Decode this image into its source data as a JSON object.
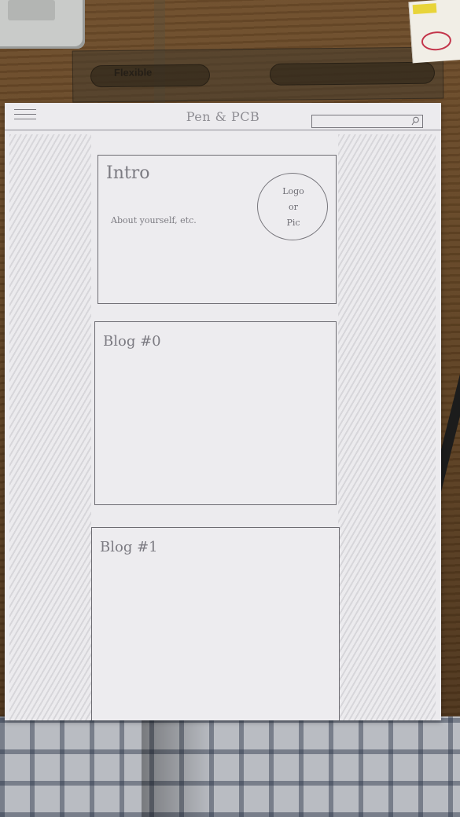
{
  "site": {
    "title": "Pen & PCB",
    "menu_icon": "hamburger-menu-icon",
    "search_icon": "search-icon"
  },
  "intro": {
    "title": "Intro",
    "text": "About yourself, etc.",
    "logo_line1": "Logo",
    "logo_line2": "or",
    "logo_line3": "Pic"
  },
  "blogs": [
    {
      "title": "Blog #0"
    },
    {
      "title": "Blog #1"
    }
  ]
}
